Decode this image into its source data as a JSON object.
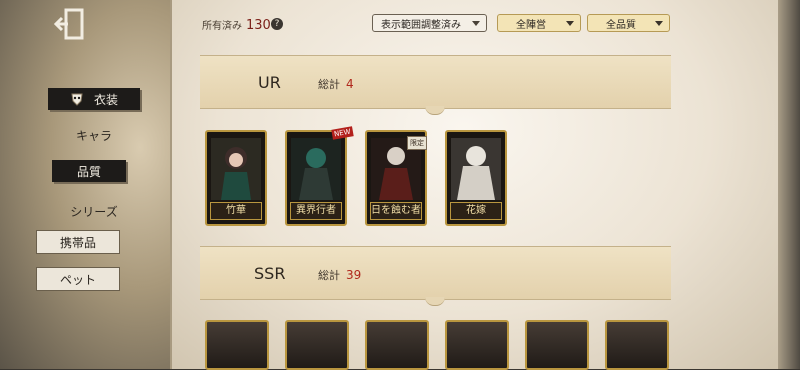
{
  "sidebar": {
    "items": [
      {
        "label": "衣装",
        "icon": "mask-icon",
        "style": "selected"
      },
      {
        "label": "キャラ",
        "style": "plain"
      },
      {
        "label": "品質",
        "style": "selected"
      },
      {
        "label": "シリーズ",
        "style": "plain"
      },
      {
        "label": "携帯品",
        "style": "boxed"
      },
      {
        "label": "ペット",
        "style": "boxed"
      }
    ]
  },
  "header": {
    "owned_label": "所有済み",
    "owned_count": "130",
    "help_icon": "?",
    "range_filter": "表示範囲調整済み",
    "camp_filter": "全陣営",
    "quality_filter": "全品質"
  },
  "tiers": [
    {
      "name": "UR",
      "total_label": "総計",
      "total_count": "4",
      "cards": [
        {
          "name": "竹華",
          "badge": ""
        },
        {
          "name": "異界行者",
          "badge": "NEW"
        },
        {
          "name": "日を蝕む者",
          "badge": "限定"
        },
        {
          "name": "花嫁",
          "badge": ""
        }
      ]
    },
    {
      "name": "SSR",
      "total_label": "総計",
      "total_count": "39",
      "cards": []
    }
  ],
  "colors": {
    "accent_red": "#b0271c",
    "card_gold": "#b9963f",
    "panel_bg": "#f5efe4",
    "sidebar_dark": "#1d1b19"
  }
}
